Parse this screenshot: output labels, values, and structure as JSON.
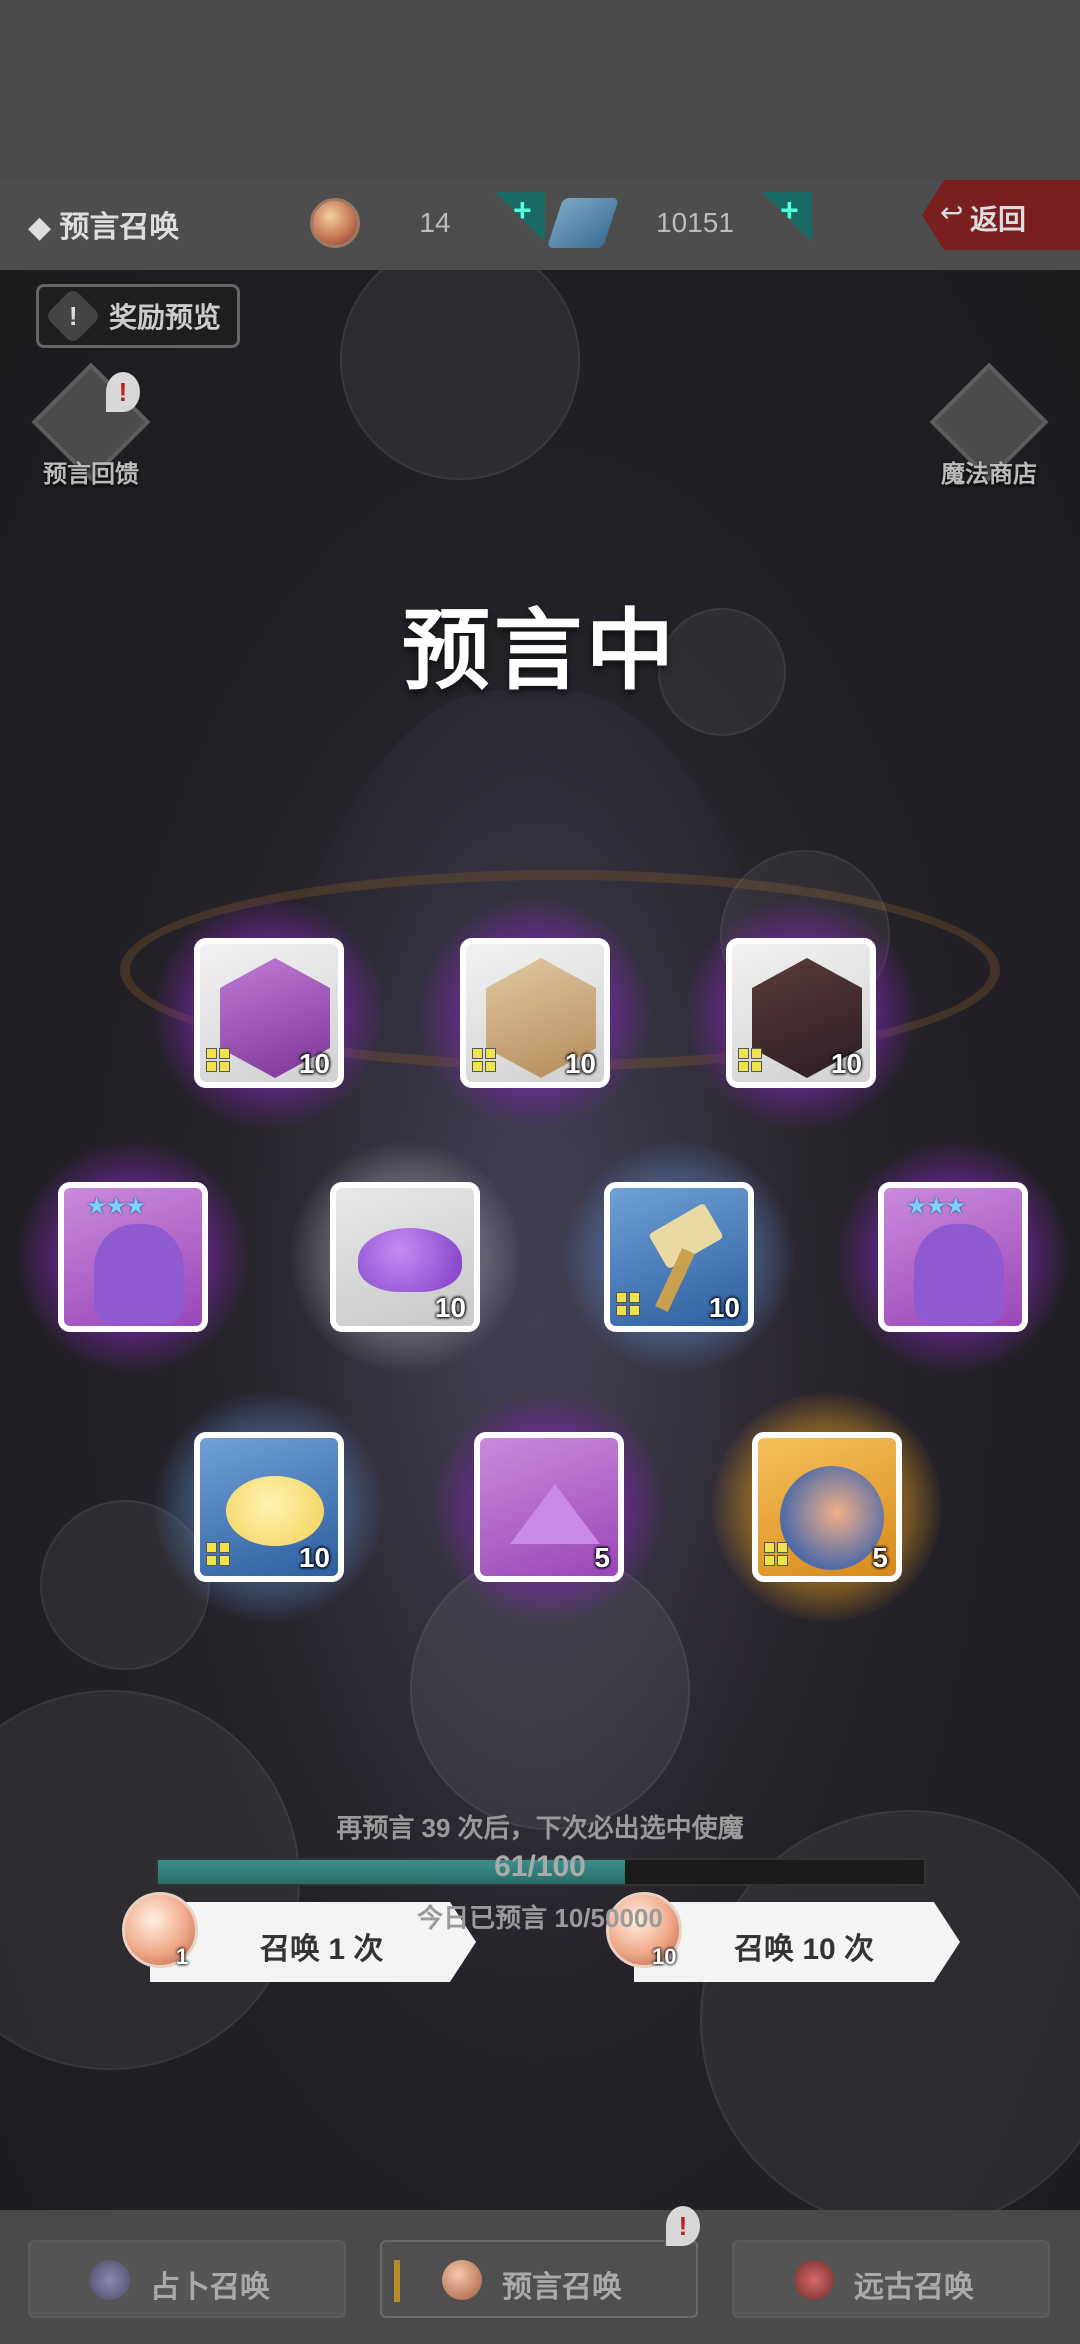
{
  "header": {
    "title": "◆ 预言召唤",
    "orb_count": "14",
    "gem_count": "10151",
    "back_label": "返回"
  },
  "side": {
    "reward_preview": "奖励预览",
    "feedback": "预言回馈",
    "magic_shop": "魔法商店"
  },
  "status_text": "预言中",
  "items": [
    {
      "qty": "10",
      "rarity": "purple",
      "kind": "character"
    },
    {
      "qty": "10",
      "rarity": "purple",
      "kind": "character"
    },
    {
      "qty": "10",
      "rarity": "purple",
      "kind": "character"
    },
    {
      "qty": "",
      "rarity": "purple",
      "kind": "pet"
    },
    {
      "qty": "10",
      "rarity": "white",
      "kind": "material"
    },
    {
      "qty": "10",
      "rarity": "blue",
      "kind": "hammer"
    },
    {
      "qty": "",
      "rarity": "purple",
      "kind": "pet"
    },
    {
      "qty": "10",
      "rarity": "blue",
      "kind": "fluff"
    },
    {
      "qty": "5",
      "rarity": "purple",
      "kind": "crystal"
    },
    {
      "qty": "5",
      "rarity": "gold",
      "kind": "book"
    }
  ],
  "summon": {
    "single_label": "召唤 1 次",
    "single_cost": "1",
    "ten_label": "召唤 10 次",
    "ten_cost": "10"
  },
  "pity": {
    "hint": "再预言 39 次后，下次必出选中使魔",
    "progress_text": "61/100",
    "progress": 0.61,
    "today": "今日已预言 10/50000"
  },
  "tabs": [
    {
      "label": "占卜召唤"
    },
    {
      "label": "预言召唤"
    },
    {
      "label": "远古召唤"
    }
  ],
  "colors": {
    "purple_glow": "#a03cc8",
    "blue_glow": "#78a0d2",
    "gold_glow": "#ffbe3c",
    "progress": "#3b8f8a",
    "back_button": "#7a1f1f"
  }
}
